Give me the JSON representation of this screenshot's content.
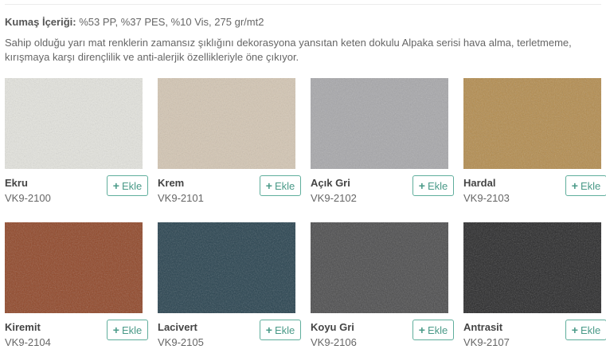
{
  "content": {
    "label": "Kumaş İçeriği:",
    "value": "%53 PP, %37 PES, %10 Vis, 275 gr/mt2"
  },
  "description": "Sahip olduğu yarı mat renklerin zamansız şıklığını dekorasyona yansıtan keten dokulu Alpaka serisi hava alma, terletmeme, kırışmaya karşı dirençlilik ve anti-alerjik özellikleriyle öne çıkıyor.",
  "add_label": "Ekle",
  "plus_icon": "+",
  "fabrics": [
    {
      "name": "Ekru",
      "code": "VK9-2100",
      "color": "#e4e4de"
    },
    {
      "name": "Krem",
      "code": "VK9-2101",
      "color": "#d4c6b3"
    },
    {
      "name": "Açık Gri",
      "code": "VK9-2102",
      "color": "#a7a7aa"
    },
    {
      "name": "Hardal",
      "code": "VK9-2103",
      "color": "#b38b4c"
    },
    {
      "name": "Kiremit",
      "code": "VK9-2104",
      "color": "#8f4425"
    },
    {
      "name": "Lacivert",
      "code": "VK9-2105",
      "color": "#243f4c"
    },
    {
      "name": "Koyu Gri",
      "code": "VK9-2106",
      "color": "#4a4a4b"
    },
    {
      "name": "Antrasit",
      "code": "VK9-2107",
      "color": "#262627"
    }
  ]
}
